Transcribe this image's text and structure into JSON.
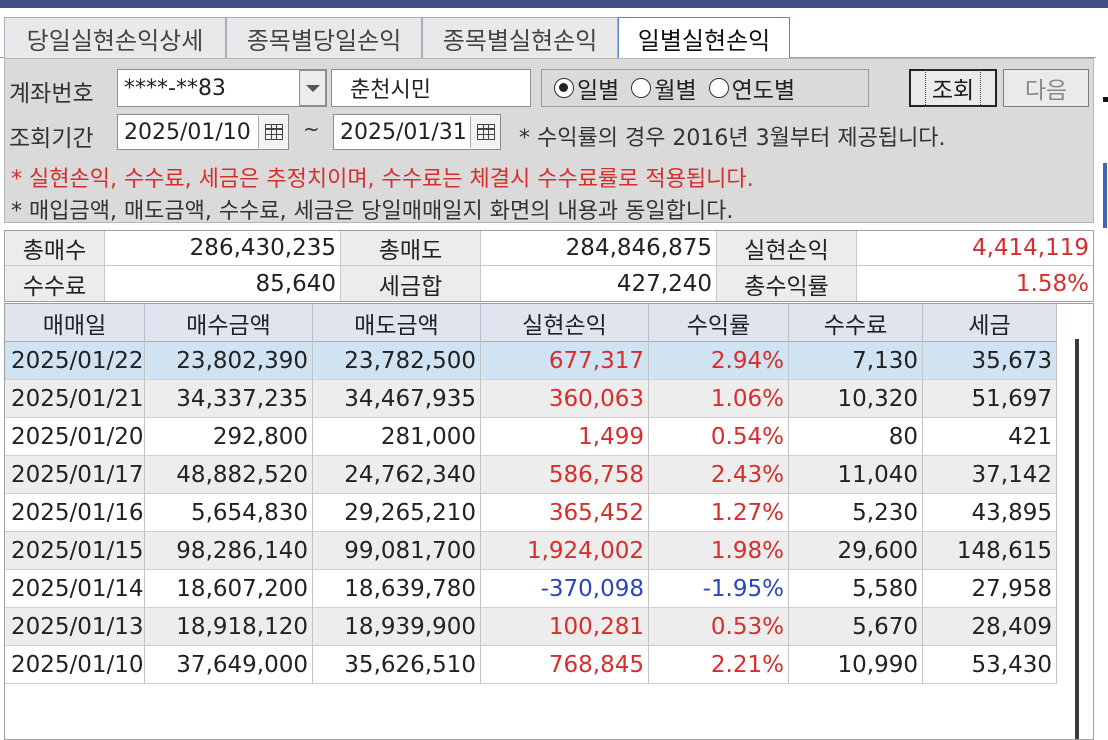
{
  "tabs": [
    {
      "label": "당일실현손익상세",
      "active": false
    },
    {
      "label": "종목별당일손익",
      "active": false
    },
    {
      "label": "종목별실현손익",
      "active": false
    },
    {
      "label": "일별실현손익",
      "active": true
    }
  ],
  "form": {
    "account_label": "계좌번호",
    "account_value": "****-**83",
    "account_name": "춘천시민",
    "radios": [
      {
        "label": "일별",
        "checked": true
      },
      {
        "label": "월별",
        "checked": false
      },
      {
        "label": "연도별",
        "checked": false
      }
    ],
    "query_button": "조회",
    "next_button": "다음",
    "period_label": "조회기간",
    "date_from": "2025/01/10",
    "date_sep": "~",
    "date_to": "2025/01/31",
    "period_note": "* 수익률의 경우 2016년 3월부터 제공됩니다.",
    "note_red": "* 실현손익, 수수료, 세금은 추정치이며, 수수료는 체결시 수수료률로 적용됩니다.",
    "note_black": "* 매입금액, 매도금액, 수수료, 세금은 당일매매일지 화면의 내용과 동일합니다."
  },
  "summary": {
    "total_buy_label": "총매수",
    "total_buy": "286,430,235",
    "total_sell_label": "총매도",
    "total_sell": "284,846,875",
    "realized_label": "실현손익",
    "realized": "4,414,119",
    "fee_label": "수수료",
    "fee": "85,640",
    "tax_label": "세금합",
    "tax": "427,240",
    "return_label": "총수익률",
    "return": "1.58%"
  },
  "table": {
    "columns": [
      "매매일",
      "매수금액",
      "매도금액",
      "실현손익",
      "수익률",
      "수수료",
      "세금"
    ],
    "rows": [
      [
        "2025/01/22",
        "23,802,390",
        "23,782,500",
        "677,317",
        "2.94%",
        "7,130",
        "35,673"
      ],
      [
        "2025/01/21",
        "34,337,235",
        "34,467,935",
        "360,063",
        "1.06%",
        "10,320",
        "51,697"
      ],
      [
        "2025/01/20",
        "292,800",
        "281,000",
        "1,499",
        "0.54%",
        "80",
        "421"
      ],
      [
        "2025/01/17",
        "48,882,520",
        "24,762,340",
        "586,758",
        "2.43%",
        "11,040",
        "37,142"
      ],
      [
        "2025/01/16",
        "5,654,830",
        "29,265,210",
        "365,452",
        "1.27%",
        "5,230",
        "43,895"
      ],
      [
        "2025/01/15",
        "98,286,140",
        "99,081,700",
        "1,924,002",
        "1.98%",
        "29,600",
        "148,615"
      ],
      [
        "2025/01/14",
        "18,607,200",
        "18,639,780",
        "-370,098",
        "-1.95%",
        "5,580",
        "27,958"
      ],
      [
        "2025/01/13",
        "18,918,120",
        "18,939,900",
        "100,281",
        "0.53%",
        "5,670",
        "28,409"
      ],
      [
        "2025/01/10",
        "37,649,000",
        "35,626,510",
        "768,845",
        "2.21%",
        "10,990",
        "53,430"
      ]
    ],
    "selected_row": 0
  },
  "colors": {
    "profit": "#d62d2d",
    "loss": "#2b46b8",
    "selected_row": "#cfe3f3",
    "header_bar": "#3f4f86"
  }
}
